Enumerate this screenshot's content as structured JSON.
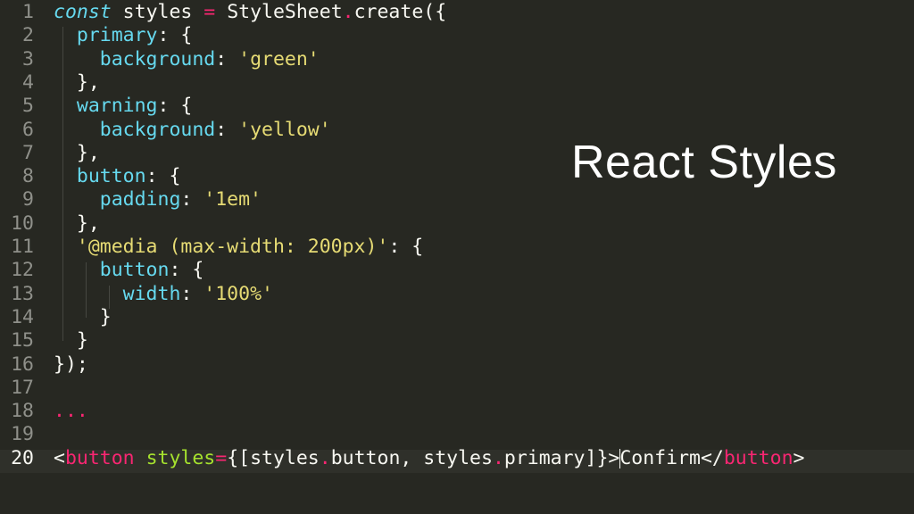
{
  "slide": {
    "title": "React Styles"
  },
  "editor": {
    "active_line": 20,
    "line_numbers": [
      "1",
      "2",
      "3",
      "4",
      "5",
      "6",
      "7",
      "8",
      "9",
      "10",
      "11",
      "12",
      "13",
      "14",
      "15",
      "16",
      "17",
      "18",
      "19",
      "20"
    ],
    "lines": [
      [
        {
          "t": "const",
          "c": "kw-i"
        },
        {
          "t": " styles ",
          "c": "ident"
        },
        {
          "t": "=",
          "c": "op"
        },
        {
          "t": " StyleSheet",
          "c": "ident"
        },
        {
          "t": ".",
          "c": "op"
        },
        {
          "t": "create({",
          "c": "ident"
        }
      ],
      [
        {
          "t": "  ",
          "c": "ident"
        },
        {
          "t": "primary",
          "c": "prop"
        },
        {
          "t": ": {",
          "c": "punc"
        }
      ],
      [
        {
          "t": "    ",
          "c": "ident"
        },
        {
          "t": "background",
          "c": "prop"
        },
        {
          "t": ": ",
          "c": "punc"
        },
        {
          "t": "'green'",
          "c": "str"
        }
      ],
      [
        {
          "t": "  },",
          "c": "punc"
        }
      ],
      [
        {
          "t": "  ",
          "c": "ident"
        },
        {
          "t": "warning",
          "c": "prop"
        },
        {
          "t": ": {",
          "c": "punc"
        }
      ],
      [
        {
          "t": "    ",
          "c": "ident"
        },
        {
          "t": "background",
          "c": "prop"
        },
        {
          "t": ": ",
          "c": "punc"
        },
        {
          "t": "'yellow'",
          "c": "str"
        }
      ],
      [
        {
          "t": "  },",
          "c": "punc"
        }
      ],
      [
        {
          "t": "  ",
          "c": "ident"
        },
        {
          "t": "button",
          "c": "prop"
        },
        {
          "t": ": {",
          "c": "punc"
        }
      ],
      [
        {
          "t": "    ",
          "c": "ident"
        },
        {
          "t": "padding",
          "c": "prop"
        },
        {
          "t": ": ",
          "c": "punc"
        },
        {
          "t": "'1em'",
          "c": "str"
        }
      ],
      [
        {
          "t": "  },",
          "c": "punc"
        }
      ],
      [
        {
          "t": "  ",
          "c": "ident"
        },
        {
          "t": "'@media (max-width: 200px)'",
          "c": "str"
        },
        {
          "t": ": {",
          "c": "punc"
        }
      ],
      [
        {
          "t": "    ",
          "c": "ident"
        },
        {
          "t": "button",
          "c": "prop"
        },
        {
          "t": ": {",
          "c": "punc"
        }
      ],
      [
        {
          "t": "      ",
          "c": "ident"
        },
        {
          "t": "width",
          "c": "prop"
        },
        {
          "t": ": ",
          "c": "punc"
        },
        {
          "t": "'100%'",
          "c": "str"
        }
      ],
      [
        {
          "t": "    }",
          "c": "punc"
        }
      ],
      [
        {
          "t": "  }",
          "c": "punc"
        }
      ],
      [
        {
          "t": "});",
          "c": "punc"
        }
      ],
      [],
      [
        {
          "t": "...",
          "c": "dots"
        }
      ],
      [],
      [
        {
          "t": "<",
          "c": "punc"
        },
        {
          "t": "button",
          "c": "tag"
        },
        {
          "t": " ",
          "c": "punc"
        },
        {
          "t": "styles",
          "c": "attr"
        },
        {
          "t": "=",
          "c": "op"
        },
        {
          "t": "{[styles",
          "c": "punc"
        },
        {
          "t": ".",
          "c": "op"
        },
        {
          "t": "button, styles",
          "c": "punc"
        },
        {
          "t": ".",
          "c": "op"
        },
        {
          "t": "primary]}>",
          "c": "punc"
        },
        {
          "t": "|",
          "c": "cursor"
        },
        {
          "t": "Confirm</",
          "c": "punc"
        },
        {
          "t": "button",
          "c": "tag"
        },
        {
          "t": ">",
          "c": "punc"
        }
      ]
    ]
  },
  "colors": {
    "background": "#272822",
    "keyword": "#66d9ef",
    "string": "#e6db74",
    "operator": "#f92672",
    "attribute": "#a6e22e",
    "text": "#f8f8f2",
    "gutter": "#8f908a"
  }
}
